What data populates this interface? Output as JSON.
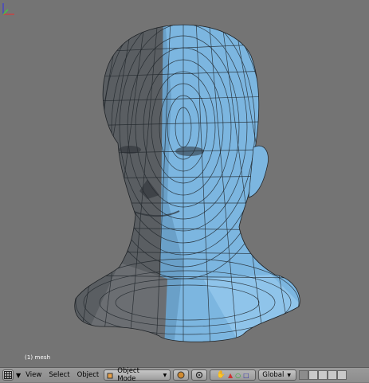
{
  "viewport": {
    "object_label": "(1) mesh",
    "background": "#747474",
    "mesh_dark": "#585c60",
    "mesh_light": "#7eb8e2",
    "wire": "#1e2226"
  },
  "header": {
    "editor_icon": "grid-editor-icon",
    "menus": [
      "View",
      "Select",
      "Object"
    ],
    "mode": "Object Mode",
    "orientation": "Global",
    "icons": [
      "triangle-down-icon",
      "mode-cube-icon",
      "shading-sphere-icon",
      "pivot-icon",
      "hand-icon",
      "triangle-icon",
      "circle-icon",
      "square-icon",
      "layers-grid-icon"
    ]
  }
}
